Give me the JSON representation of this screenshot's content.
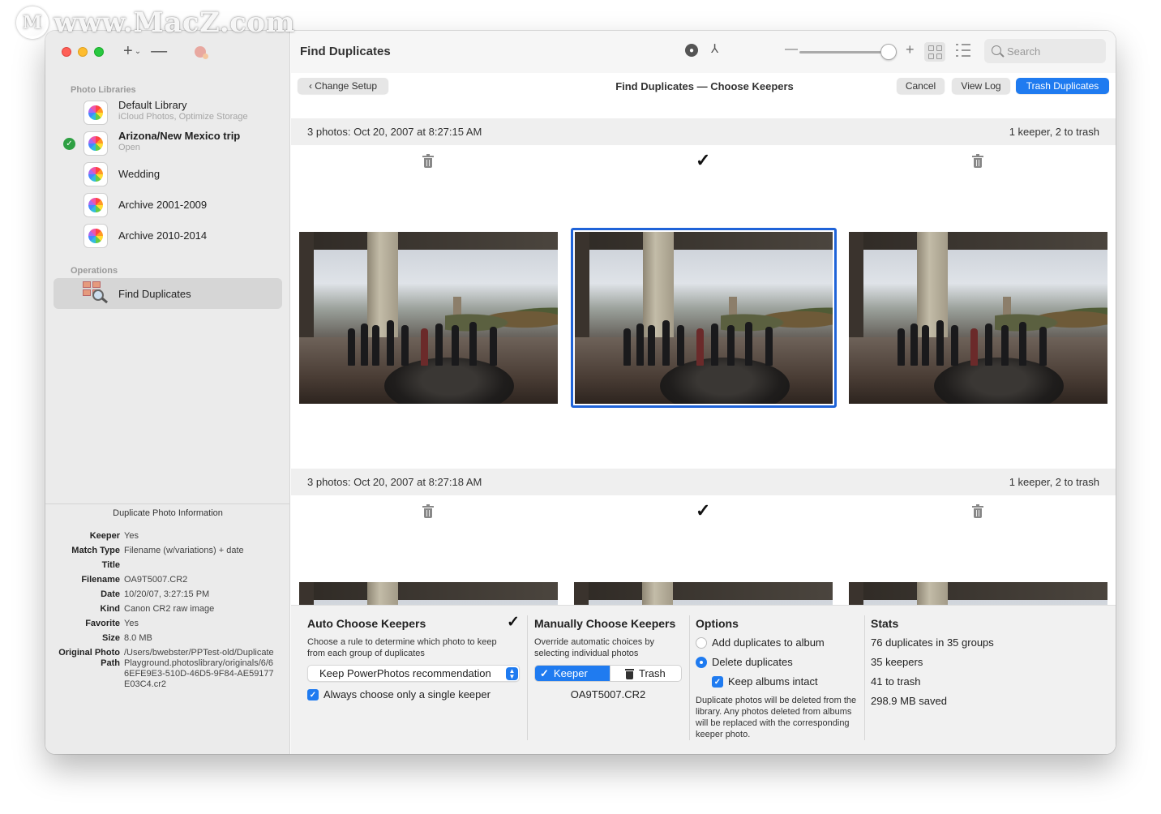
{
  "watermark": {
    "text": "www.MacZ.com",
    "logo_letter": "M"
  },
  "window": {
    "sidebar": {
      "tool_add": "+",
      "tool_chevron": "⌄",
      "tool_remove": "—",
      "libraries_heading": "Photo Libraries",
      "libraries": [
        {
          "name": "Default Library",
          "sub": "iCloud Photos, Optimize Storage",
          "bold": false,
          "checked": false
        },
        {
          "name": "Arizona/New Mexico trip",
          "sub": "Open",
          "bold": true,
          "checked": true
        },
        {
          "name": "Wedding",
          "sub": "",
          "bold": false,
          "checked": false
        },
        {
          "name": "Archive 2001-2009",
          "sub": "",
          "bold": false,
          "checked": false
        },
        {
          "name": "Archive 2010-2014",
          "sub": "",
          "bold": false,
          "checked": false
        }
      ],
      "operations_heading": "Operations",
      "operation": "Find Duplicates",
      "info": {
        "title": "Duplicate Photo Information",
        "rows": [
          {
            "k": "Keeper",
            "v": "Yes"
          },
          {
            "k": "Match Type",
            "v": "Filename (w/variations) + date"
          },
          {
            "k": "Title",
            "v": ""
          },
          {
            "k": "Filename",
            "v": "OA9T5007.CR2"
          },
          {
            "k": "Date",
            "v": "10/20/07, 3:27:15 PM"
          },
          {
            "k": "Kind",
            "v": "Canon CR2 raw image"
          },
          {
            "k": "Favorite",
            "v": "Yes"
          },
          {
            "k": "Size",
            "v": "8.0 MB"
          },
          {
            "k": "Original Photo Path",
            "v": "/Users/bwebster/PPTest-old/Duplicate Playground.photoslibrary/originals/6/66EFE9E3-510D-46D5-9F84-AE59177E03C4.cr2"
          }
        ]
      }
    },
    "toolbar": {
      "title": "Find Duplicates",
      "minus": "—",
      "plus": "+",
      "zoom_level": 0.92,
      "search_placeholder": "Search"
    },
    "subbar": {
      "back_label": "‹ Change Setup",
      "title": "Find Duplicates — Choose Keepers",
      "cancel_label": "Cancel",
      "view_log_label": "View Log",
      "trash_label": "Trash Duplicates"
    },
    "groups": [
      {
        "left": "3 photos: Oct 20, 2007 at 8:27:15 AM",
        "right": "1 keeper, 2 to trash",
        "marks": [
          "trash",
          "keep",
          "trash"
        ]
      },
      {
        "left": "3 photos: Oct 20, 2007 at 8:27:18 AM",
        "right": "1 keeper, 2 to trash",
        "marks": [
          "trash",
          "keep",
          "trash"
        ]
      }
    ],
    "check_glyph": "✓",
    "panel": {
      "auto": {
        "heading": "Auto Choose Keepers",
        "desc": "Choose a rule to determine which photo to keep from each group of duplicates",
        "popup": "Keep PowerPhotos recommendation",
        "checkbox": "Always choose only a single keeper"
      },
      "manual": {
        "heading": "Manually Choose Keepers",
        "desc": "Override automatic choices by selecting individual photos",
        "keeper": "Keeper",
        "trash": "Trash",
        "filename": "OA9T5007.CR2"
      },
      "options": {
        "heading": "Options",
        "radio_add": "Add duplicates to album",
        "radio_delete": "Delete duplicates",
        "checkbox": "Keep albums intact",
        "note": "Duplicate photos will be deleted from the library. Any photos deleted from albums will be replaced with the corresponding keeper photo."
      },
      "stats": {
        "heading": "Stats",
        "lines": [
          "76 duplicates in 35 groups",
          "35 keepers",
          "41 to trash",
          "298.9 MB saved"
        ]
      }
    },
    "colors": {
      "accent": "#1f7bf0",
      "selection": "#1f63d8",
      "sidebar": "#ebebeb"
    }
  }
}
